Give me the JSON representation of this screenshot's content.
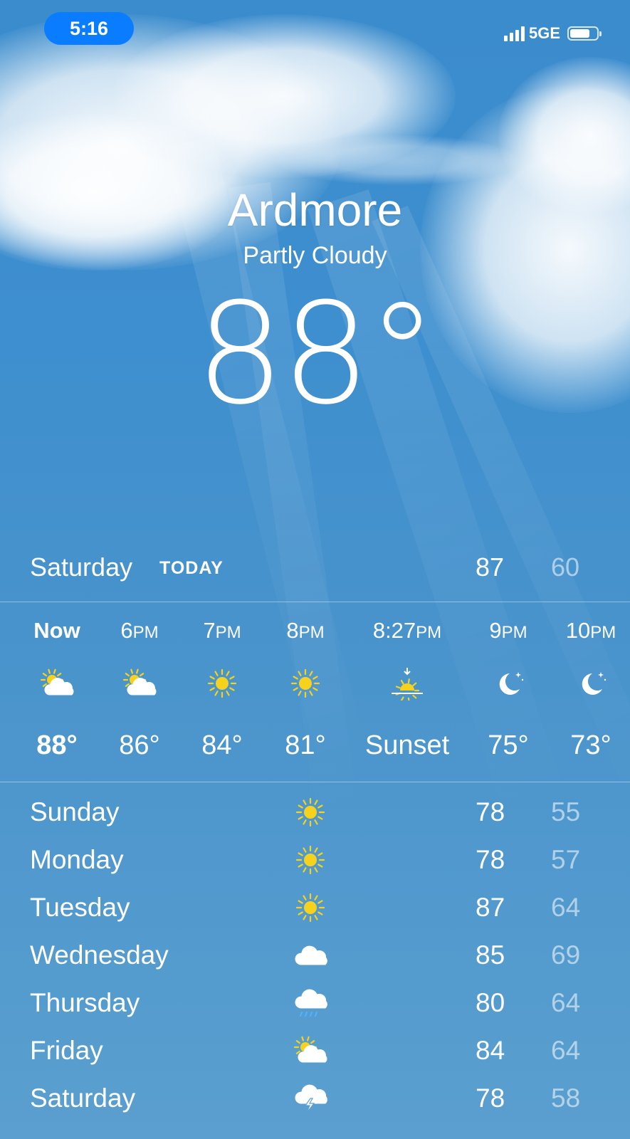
{
  "status_bar": {
    "time": "5:16",
    "network": "5GE",
    "battery_level": 0.75
  },
  "location": {
    "city": "Ardmore",
    "condition": "Partly Cloudy",
    "temperature": "88°"
  },
  "today": {
    "day": "Saturday",
    "label": "TODAY",
    "high": "87",
    "low": "60"
  },
  "hourly": [
    {
      "time": "Now",
      "icon": "partly-sunny-icon",
      "temp": "88°"
    },
    {
      "time": "6PM",
      "icon": "partly-sunny-icon",
      "temp": "86°"
    },
    {
      "time": "7PM",
      "icon": "sun-icon",
      "temp": "84°"
    },
    {
      "time": "8PM",
      "icon": "sun-icon",
      "temp": "81°"
    },
    {
      "time": "8:27PM",
      "icon": "sunset-icon",
      "temp": "Sunset"
    },
    {
      "time": "9PM",
      "icon": "moon-icon",
      "temp": "75°"
    },
    {
      "time": "10PM",
      "icon": "moon-icon",
      "temp": "73°"
    }
  ],
  "daily": [
    {
      "day": "Sunday",
      "icon": "sun-icon",
      "high": "78",
      "low": "55"
    },
    {
      "day": "Monday",
      "icon": "sun-icon",
      "high": "78",
      "low": "57"
    },
    {
      "day": "Tuesday",
      "icon": "sun-icon",
      "high": "87",
      "low": "64"
    },
    {
      "day": "Wednesday",
      "icon": "cloud-icon",
      "high": "85",
      "low": "69"
    },
    {
      "day": "Thursday",
      "icon": "rain-cloud-icon",
      "high": "80",
      "low": "64"
    },
    {
      "day": "Friday",
      "icon": "partly-sunny-icon",
      "high": "84",
      "low": "64"
    },
    {
      "day": "Saturday",
      "icon": "thunderstorm-icon",
      "high": "78",
      "low": "58"
    }
  ],
  "colors": {
    "sky": "#3e8fcf",
    "sun": "#f7d21c",
    "time_pill": "#0a7cff",
    "rain": "#4fb3ff"
  }
}
